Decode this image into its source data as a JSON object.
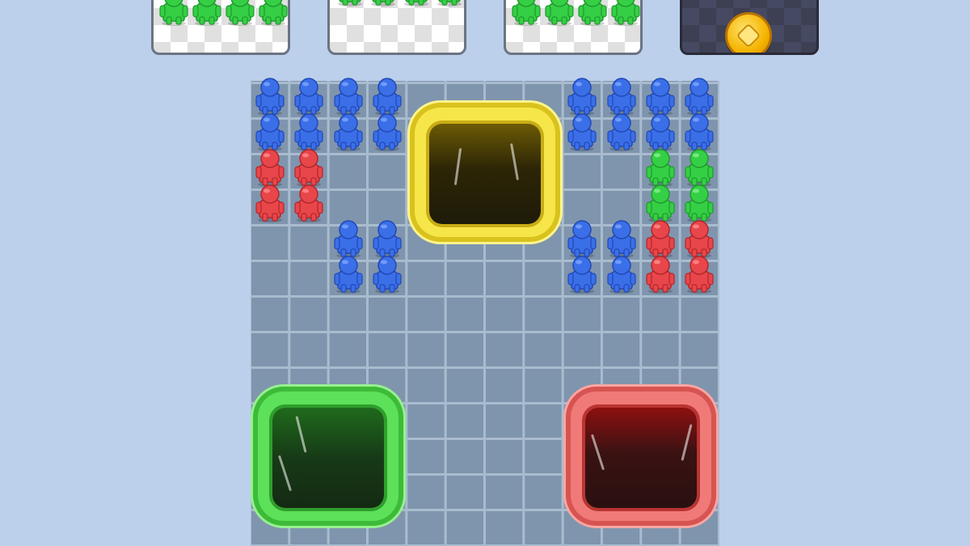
{
  "palette": {
    "background": "#bcd0ec",
    "blue": "#3a6fe8",
    "red": "#e8464a",
    "green": "#35cf45",
    "yellow": "#f7e64a"
  },
  "slots": [
    {
      "name": "slot-1",
      "content": "green-people",
      "count": 4
    },
    {
      "name": "slot-2",
      "content": "green-people",
      "count": 4
    },
    {
      "name": "slot-3",
      "content": "green-people",
      "count": 4
    },
    {
      "name": "slot-4",
      "content": "coin-icon"
    }
  ],
  "board": {
    "columns": 12,
    "holes": [
      {
        "name": "yellow-hole",
        "color": "yellow"
      },
      {
        "name": "green-hole",
        "color": "green"
      },
      {
        "name": "red-hole",
        "color": "red"
      }
    ],
    "crowds": [
      {
        "color": "blue",
        "count": 8
      },
      {
        "color": "red",
        "count": 4
      },
      {
        "color": "blue",
        "count": 4
      },
      {
        "color": "blue",
        "count": 8
      },
      {
        "color": "green",
        "count": 4
      },
      {
        "color": "blue",
        "count": 4
      },
      {
        "color": "red",
        "count": 4
      }
    ]
  }
}
